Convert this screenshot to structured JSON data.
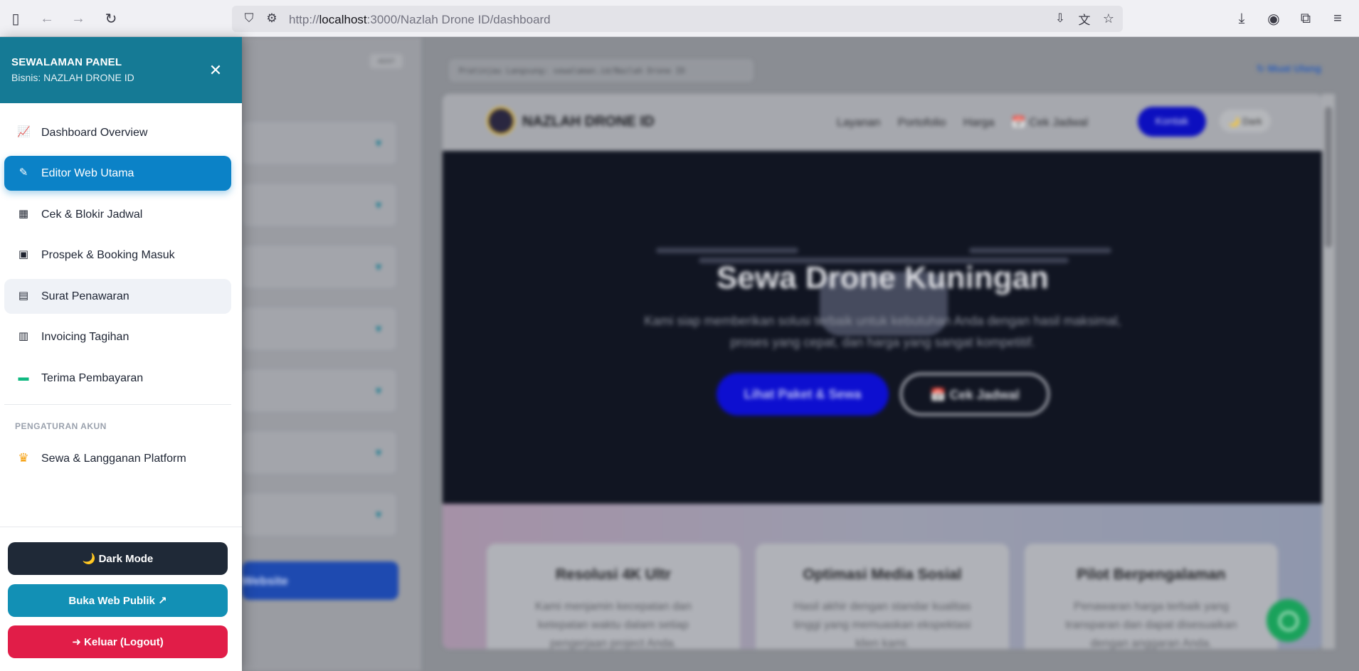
{
  "browser": {
    "url_scheme": "http://",
    "url_host": "localhost",
    "url_path": ":3000/Nazlah Drone ID/dashboard"
  },
  "drawer": {
    "title": "SEWALAMAN PANEL",
    "subtitle": "Bisnis: NAZLAH DRONE ID",
    "nav": [
      {
        "label": "Dashboard Overview",
        "icon": "📈"
      },
      {
        "label": "Editor Web Utama",
        "icon": "✎"
      },
      {
        "label": "Cek & Blokir Jadwal",
        "icon": "▦"
      },
      {
        "label": "Prospek & Booking Masuk",
        "icon": "▣"
      },
      {
        "label": "Surat Penawaran",
        "icon": "▤"
      },
      {
        "label": "Invoicing Tagihan",
        "icon": "▥"
      },
      {
        "label": "Terima Pembayaran",
        "icon": "▬"
      }
    ],
    "section_heading": "PENGATURAN AKUN",
    "account_item": {
      "label": "Sewa & Langganan Platform",
      "icon": "♛"
    },
    "dark_mode_label": "🌙 Dark Mode",
    "open_public_label": "Buka Web Publik ↗",
    "logout_label": "➜ Keluar (Logout)"
  },
  "background": {
    "badge": "ADST",
    "publish_label": "Website",
    "preview_label": "Pratinjau Langsung: sewalaman.id/Nazlah Drone ID",
    "reload_label": "↻ Muat Ulang",
    "site": {
      "brand": "NAZLAH DRONE ID",
      "links": [
        "Layanan",
        "Portofolio",
        "Harga",
        "📅 Cek Jadwal"
      ],
      "contact": "Kontak",
      "dark": "🌙 Dark",
      "hero_title": "Sewa Drone Kuningan",
      "hero_sub": "Kami siap memberikan solusi terbaik untuk kebutuhan Anda dengan hasil maksimal, proses yang cepat, dan harga yang sangat kompetitif.",
      "hero_btn1": "Lihat Paket & Sewa",
      "hero_btn2": "📅 Cek Jadwal",
      "cards": [
        {
          "title": "Resolusi 4K Ultr",
          "text": "Kami menjamin kecepatan dan ketepatan waktu dalam setiap pengerjaan project Anda."
        },
        {
          "title": "Optimasi Media Sosial",
          "text": "Hasil akhir dengan standar kualitas tinggi yang memuaskan ekspektasi klien kami."
        },
        {
          "title": "Pilot Berpengalaman",
          "text": "Penawaran harga terbaik yang transparan dan dapat disesuaikan dengan anggaran Anda."
        }
      ]
    }
  },
  "colors": {
    "header_teal": "#157a95",
    "active_blue": "#0b82c7",
    "dark_btn": "#1f2937",
    "public_btn": "#1290b5",
    "logout_btn": "#e11d48"
  }
}
